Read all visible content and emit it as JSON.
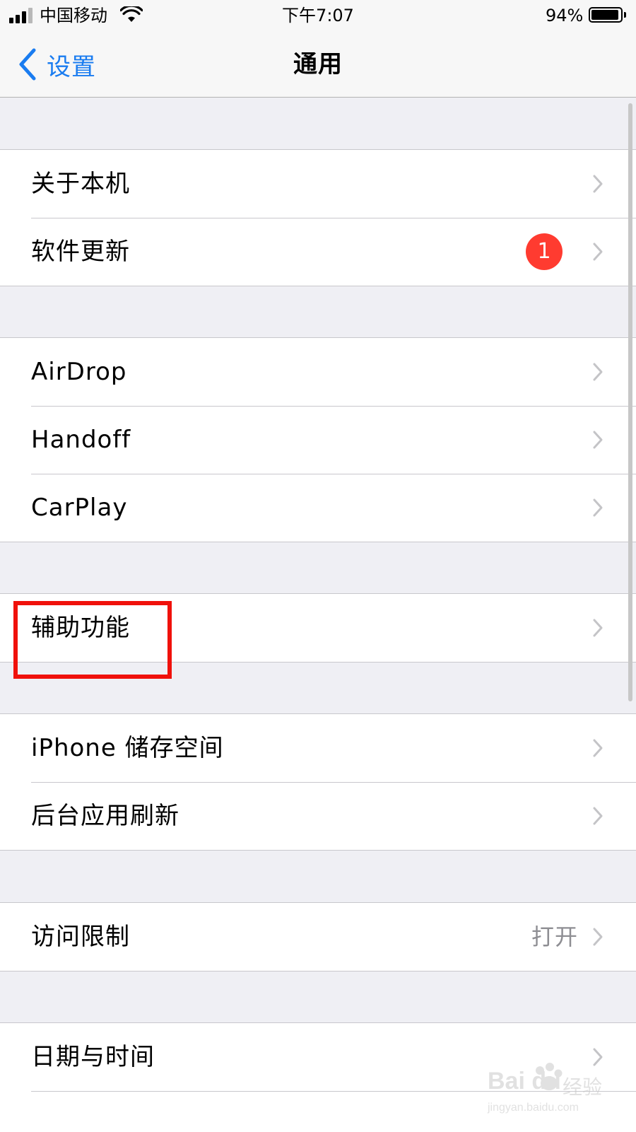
{
  "status_bar": {
    "carrier": "中国移动",
    "time": "下午7:07",
    "battery_percent_label": "94%",
    "battery_level": 0.94
  },
  "nav": {
    "back_label": "设置",
    "title": "通用"
  },
  "groups": [
    {
      "rows": [
        {
          "label": "关于本机"
        },
        {
          "label": "软件更新",
          "badge": "1"
        }
      ]
    },
    {
      "rows": [
        {
          "label": "AirDrop"
        },
        {
          "label": "Handoff"
        },
        {
          "label": "CarPlay"
        }
      ]
    },
    {
      "rows": [
        {
          "label": "辅助功能",
          "highlighted": true
        }
      ]
    },
    {
      "rows": [
        {
          "label": "iPhone 储存空间"
        },
        {
          "label": "后台应用刷新"
        }
      ]
    },
    {
      "rows": [
        {
          "label": "访问限制",
          "value": "打开"
        }
      ]
    },
    {
      "rows": [
        {
          "label": "日期与时间"
        }
      ]
    }
  ],
  "colors": {
    "accent": "#1a7cf0",
    "badge": "#ff3b30",
    "highlight": "#f0110b",
    "background": "#efeff4"
  },
  "watermark": {
    "logo": "Bai du",
    "text": "经验",
    "url": "jingyan.baidu.com"
  }
}
